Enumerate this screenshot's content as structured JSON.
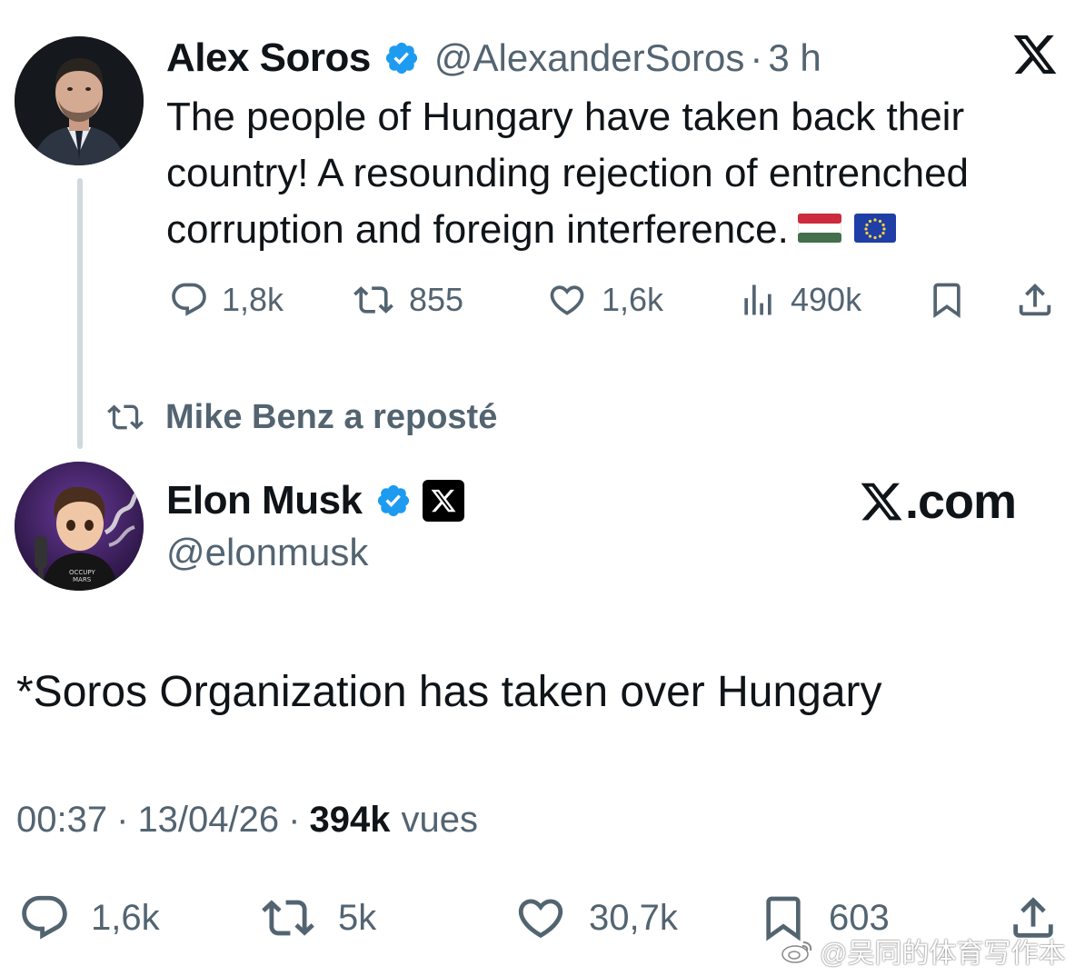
{
  "quoted_tweet": {
    "author_name": "Alex Soros",
    "handle": "@AlexanderSoros",
    "separator": "·",
    "time": "3 h",
    "text": "The people of Hungary have taken back their country! A resounding rejection of entrenched corruption and foreign interference.",
    "flags": [
      "hungary-flag-icon",
      "eu-flag-icon"
    ],
    "actions": {
      "replies": "1,8k",
      "reposts": "855",
      "likes": "1,6k",
      "views": "490k"
    }
  },
  "repost_banner": {
    "text": "Mike Benz a reposté"
  },
  "main_tweet": {
    "author_name": "Elon Musk",
    "handle": "@elonmusk",
    "site_label": ".com",
    "text": "*Soros Organization has taken over Hungary",
    "meta": {
      "time": "00:37",
      "date": "13/04/26",
      "separator": "·",
      "views_count": "394k",
      "views_label": "vues"
    },
    "actions": {
      "replies": "1,6k",
      "reposts": "5k",
      "likes": "30,7k",
      "bookmarks": "603"
    }
  },
  "watermark": {
    "text": "@吴同的体育写作本"
  },
  "colors": {
    "text_primary": "#0f1419",
    "text_secondary": "#536471",
    "verified_blue": "#1d9bf0",
    "thread_line": "#cfd9de"
  }
}
